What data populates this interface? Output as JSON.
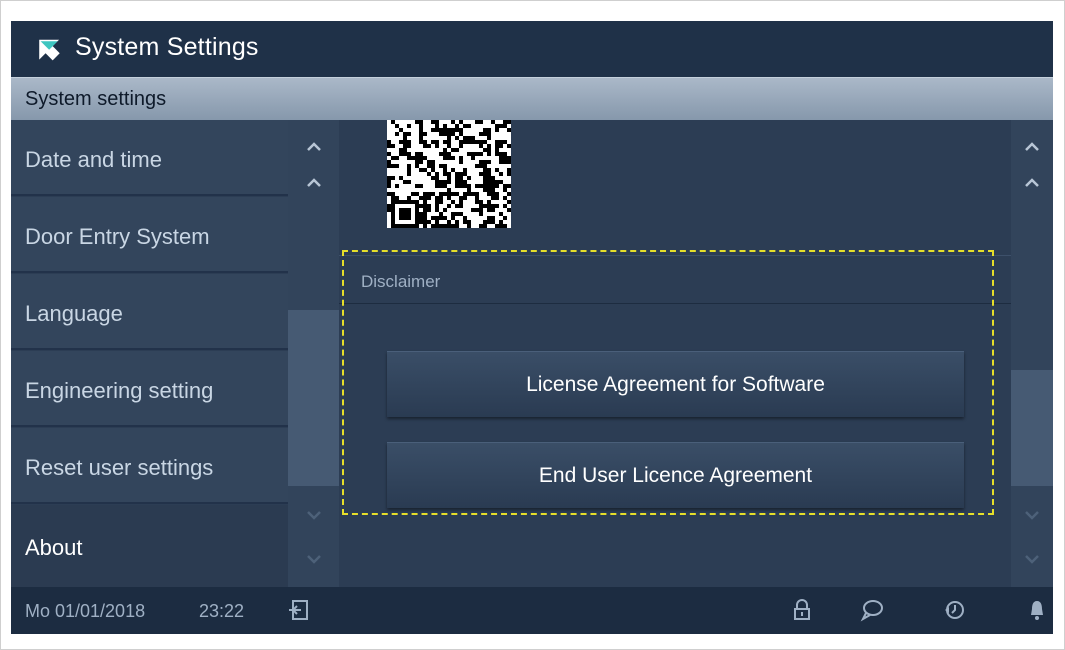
{
  "header": {
    "title": "System Settings",
    "back_icon": "back-arrow-icon"
  },
  "section": {
    "title": "System settings"
  },
  "menu": {
    "items": [
      {
        "label": "Date and time"
      },
      {
        "label": "Door Entry System"
      },
      {
        "label": "Language"
      },
      {
        "label": "Engineering setting"
      },
      {
        "label": "Reset user settings"
      },
      {
        "label": "About",
        "active": true
      }
    ]
  },
  "content": {
    "disclaimer_label": "Disclaimer",
    "buttons": [
      {
        "label": "License Agreement for Software"
      },
      {
        "label": "End User Licence Agreement"
      }
    ]
  },
  "status": {
    "date": "Mo 01/01/2018",
    "time": "23:22",
    "icons": [
      "logout-icon",
      "lock-icon",
      "message-icon",
      "history-icon",
      "bell-icon"
    ]
  },
  "colors": {
    "background": "#2c3d54",
    "title_bar": "#1f3148",
    "section_bar": "#9aaabd",
    "highlight": "#e6df2a",
    "accent_teal": "#3ec6c0"
  }
}
